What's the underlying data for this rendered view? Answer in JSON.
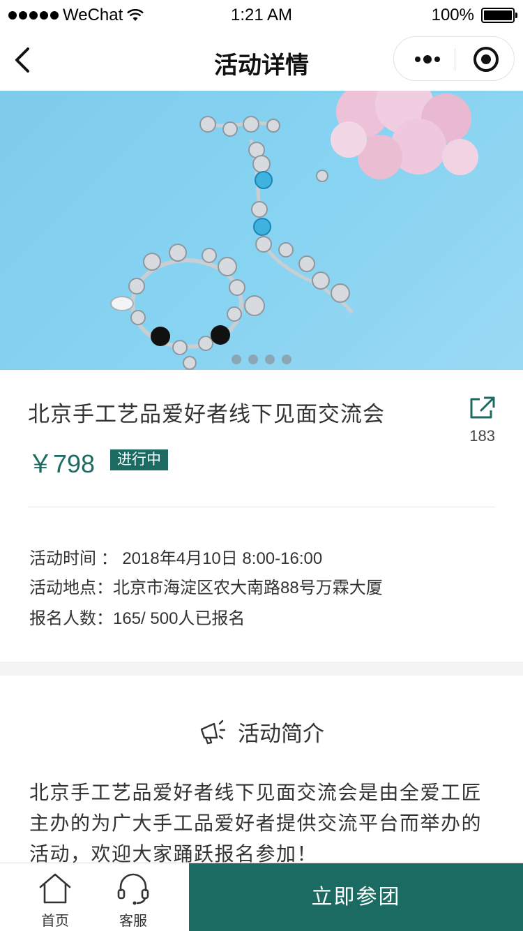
{
  "status_bar": {
    "carrier": "WeChat",
    "time": "1:21 AM",
    "battery": "100%"
  },
  "nav": {
    "title": "活动详情",
    "icons": [
      "back-icon",
      "more-icon",
      "close-icon"
    ]
  },
  "banner": {
    "page_count": 4,
    "active_index": 0
  },
  "activity": {
    "title": "北京手工艺品爱好者线下见面交流会",
    "share_count": "183",
    "price": "￥798",
    "status_badge": "进行中",
    "time": "活动时间 ： 2018年4月10日  8:00-16:00",
    "location": "活动地点：北京市海淀区农大南路88号万霖大厦",
    "signup": "报名人数：165/ 500人已报名"
  },
  "intro": {
    "title": "活动简介",
    "text": "北京手工艺品爱好者线下见面交流会是由全爱工匠主办的为广大手工品爱好者提供交流平台而举办的活动，欢迎大家踊跃报名参加！"
  },
  "tabbar": {
    "home_label": "首页",
    "service_label": "客服",
    "join_label": "立即参团"
  },
  "colors": {
    "primary": "#1c6b62",
    "banner_bg": "#86d3f2"
  }
}
